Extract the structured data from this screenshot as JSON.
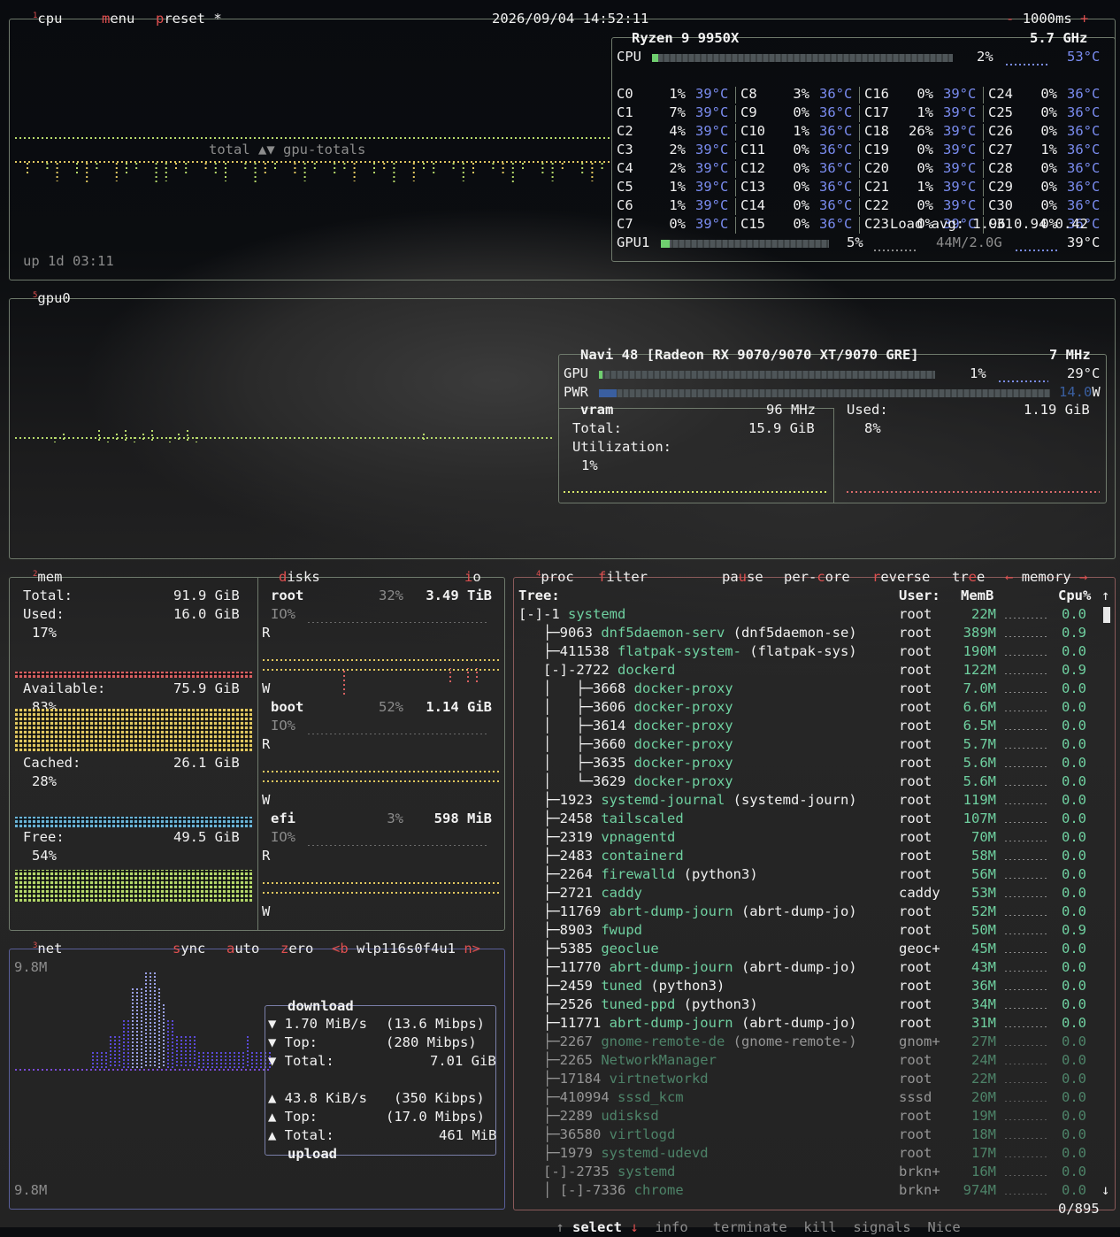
{
  "header": {
    "cpu_tab": "cpu",
    "cpu_num": "1",
    "menu": "menu",
    "preset": "preset *",
    "datetime": "2026/09/04 14:52:11",
    "rate_minus": "-",
    "rate": "1000ms",
    "rate_plus": "+"
  },
  "cpu": {
    "model": "Ryzen 9 9950X",
    "freq": "5.7 GHz",
    "label": "CPU",
    "total_pct": "2%",
    "total_temp": "53°C",
    "total_pct_value": 2,
    "graph_label_left": "total ▲▼",
    "graph_label_right": "gpu-totals",
    "uptime": "up 1d 03:11",
    "cores": [
      [
        "C0",
        "1%",
        "39°C"
      ],
      [
        "C1",
        "7%",
        "39°C"
      ],
      [
        "C2",
        "4%",
        "39°C"
      ],
      [
        "C3",
        "2%",
        "39°C"
      ],
      [
        "C4",
        "2%",
        "39°C"
      ],
      [
        "C5",
        "1%",
        "39°C"
      ],
      [
        "C6",
        "1%",
        "39°C"
      ],
      [
        "C7",
        "0%",
        "39°C"
      ],
      [
        "C8",
        "3%",
        "36°C"
      ],
      [
        "C9",
        "0%",
        "36°C"
      ],
      [
        "C10",
        "1%",
        "36°C"
      ],
      [
        "C11",
        "0%",
        "36°C"
      ],
      [
        "C12",
        "0%",
        "36°C"
      ],
      [
        "C13",
        "0%",
        "36°C"
      ],
      [
        "C14",
        "0%",
        "36°C"
      ],
      [
        "C15",
        "0%",
        "36°C"
      ],
      [
        "C16",
        "0%",
        "39°C"
      ],
      [
        "C17",
        "1%",
        "39°C"
      ],
      [
        "C18",
        "26%",
        "39°C"
      ],
      [
        "C19",
        "0%",
        "39°C"
      ],
      [
        "C20",
        "0%",
        "39°C"
      ],
      [
        "C21",
        "1%",
        "39°C"
      ],
      [
        "C22",
        "0%",
        "39°C"
      ],
      [
        "C23",
        "0%",
        "39°C"
      ],
      [
        "C24",
        "0%",
        "36°C"
      ],
      [
        "C25",
        "0%",
        "36°C"
      ],
      [
        "C26",
        "0%",
        "36°C"
      ],
      [
        "C27",
        "1%",
        "36°C"
      ],
      [
        "C28",
        "0%",
        "36°C"
      ],
      [
        "C29",
        "0%",
        "36°C"
      ],
      [
        "C30",
        "0%",
        "36°C"
      ],
      [
        "C31",
        "0%",
        "36°C"
      ]
    ],
    "load_avg": "Load avg: 1.96 0.94 0.42",
    "gpu_label": "GPU1",
    "gpu_pct": "5%",
    "gpu_pct_value": 5,
    "gpu_mem": "44M/2.0G",
    "gpu_temp": "39°C"
  },
  "gpu0": {
    "tab": "gpu0",
    "num": "5",
    "name": "Navi 48 [Radeon RX 9070/9070 XT/9070 GRE]",
    "clock": "7 MHz",
    "gpu_label": "GPU",
    "gpu_pct": "1%",
    "gpu_pct_value": 1,
    "gpu_temp": "29°C",
    "pwr_label": "PWR",
    "pwr_val": "14.0",
    "pwr_unit": "W",
    "vram_label": "vram",
    "vram_clock": "96 MHz",
    "total_label": "Total:",
    "total_val": "15.9 GiB",
    "util_label": "Utilization:",
    "util_val": "1%",
    "used_label": "Used:",
    "used_val": "1.19 GiB",
    "used_pct": "8%"
  },
  "mem": {
    "tab": "mem",
    "num": "2",
    "total_label": "Total:",
    "total_val": "91.9 GiB",
    "used_label": "Used:",
    "used_val": "16.0 GiB",
    "used_pct": "17%",
    "avail_label": "Available:",
    "avail_val": "75.9 GiB",
    "avail_pct": "83%",
    "cached_label": "Cached:",
    "cached_val": "26.1 GiB",
    "cached_pct": "28%",
    "free_label": "Free:",
    "free_val": "49.5 GiB",
    "free_pct": "54%"
  },
  "disks": {
    "tab": "disks",
    "io_tab": "io",
    "items": [
      {
        "name": "root",
        "pct": "32%",
        "size": "3.49 TiB",
        "io": "IO%",
        "r": "R",
        "w": "W"
      },
      {
        "name": "boot",
        "pct": "52%",
        "size": "1.14 GiB",
        "io": "IO%",
        "r": "R",
        "w": "W"
      },
      {
        "name": "efi",
        "pct": "3%",
        "size": "598 MiB",
        "io": "IO%",
        "r": "R",
        "w": "W"
      }
    ]
  },
  "net": {
    "tab": "net",
    "num": "3",
    "sync": "sync",
    "auto": "auto",
    "zero": "zero",
    "prev": "<b",
    "iface": "wlp116s0f4u1",
    "next": "n>",
    "scale_top": "9.8M",
    "scale_bottom": "9.8M",
    "download_title": "download",
    "dl_rate": "▼ 1.70 MiB/s",
    "dl_rate_bits": "(13.6 Mibps)",
    "dl_top_label": "▼ Top:",
    "dl_top": "(280 Mibps)",
    "dl_total_label": "▼ Total:",
    "dl_total": "7.01 GiB",
    "ul_rate": "▲ 43.8 KiB/s",
    "ul_rate_bits": "(350 Kibps)",
    "ul_top_label": "▲ Top:",
    "ul_top": "(17.0 Mibps)",
    "ul_total_label": "▲ Total:",
    "ul_total": "461 MiB",
    "upload_title": "upload"
  },
  "proc": {
    "tab": "proc",
    "num": "4",
    "filter": "filter",
    "pause": "pause",
    "per_core": "per-core",
    "reverse": "reverse",
    "tree": "tree",
    "sort_left": "←",
    "sort": "memory",
    "sort_right": "→",
    "col_tree": "Tree:",
    "col_user": "User:",
    "col_mem": "MemB",
    "col_cpu": "Cpu%",
    "rows": [
      {
        "tree": "[-]-1 ",
        "name": "systemd",
        "args": "",
        "user": "root",
        "mem": "22M",
        "cpu": "0.0"
      },
      {
        "tree": "   ├─9063 ",
        "name": "dnf5daemon-serv",
        "args": " (dnf5daemon-se)",
        "user": "root",
        "mem": "389M",
        "cpu": "0.9"
      },
      {
        "tree": "   ├─411538 ",
        "name": "flatpak-system-",
        "args": " (flatpak-sys)",
        "user": "root",
        "mem": "190M",
        "cpu": "0.0"
      },
      {
        "tree": "   [-]-2722 ",
        "name": "dockerd",
        "args": "",
        "user": "root",
        "mem": "122M",
        "cpu": "0.9"
      },
      {
        "tree": "   │   ├─3668 ",
        "name": "docker-proxy",
        "args": "",
        "user": "root",
        "mem": "7.0M",
        "cpu": "0.0"
      },
      {
        "tree": "   │   ├─3606 ",
        "name": "docker-proxy",
        "args": "",
        "user": "root",
        "mem": "6.6M",
        "cpu": "0.0"
      },
      {
        "tree": "   │   ├─3614 ",
        "name": "docker-proxy",
        "args": "",
        "user": "root",
        "mem": "6.5M",
        "cpu": "0.0"
      },
      {
        "tree": "   │   ├─3660 ",
        "name": "docker-proxy",
        "args": "",
        "user": "root",
        "mem": "5.7M",
        "cpu": "0.0"
      },
      {
        "tree": "   │   ├─3635 ",
        "name": "docker-proxy",
        "args": "",
        "user": "root",
        "mem": "5.6M",
        "cpu": "0.0"
      },
      {
        "tree": "   │   └─3629 ",
        "name": "docker-proxy",
        "args": "",
        "user": "root",
        "mem": "5.6M",
        "cpu": "0.0"
      },
      {
        "tree": "   ├─1923 ",
        "name": "systemd-journal",
        "args": " (systemd-journ)",
        "user": "root",
        "mem": "119M",
        "cpu": "0.0"
      },
      {
        "tree": "   ├─2458 ",
        "name": "tailscaled",
        "args": "",
        "user": "root",
        "mem": "107M",
        "cpu": "0.0"
      },
      {
        "tree": "   ├─2319 ",
        "name": "vpnagentd",
        "args": "",
        "user": "root",
        "mem": "70M",
        "cpu": "0.0"
      },
      {
        "tree": "   ├─2483 ",
        "name": "containerd",
        "args": "",
        "user": "root",
        "mem": "58M",
        "cpu": "0.0"
      },
      {
        "tree": "   ├─2264 ",
        "name": "firewalld",
        "args": " (python3)",
        "user": "root",
        "mem": "56M",
        "cpu": "0.0"
      },
      {
        "tree": "   ├─2721 ",
        "name": "caddy",
        "args": "",
        "user": "caddy",
        "mem": "53M",
        "cpu": "0.0"
      },
      {
        "tree": "   ├─11769 ",
        "name": "abrt-dump-journ",
        "args": " (abrt-dump-jo)",
        "user": "root",
        "mem": "52M",
        "cpu": "0.0"
      },
      {
        "tree": "   ├─8903 ",
        "name": "fwupd",
        "args": "",
        "user": "root",
        "mem": "50M",
        "cpu": "0.9"
      },
      {
        "tree": "   ├─5385 ",
        "name": "geoclue",
        "args": "",
        "user": "geoc+",
        "mem": "45M",
        "cpu": "0.0"
      },
      {
        "tree": "   ├─11770 ",
        "name": "abrt-dump-journ",
        "args": " (abrt-dump-jo)",
        "user": "root",
        "mem": "43M",
        "cpu": "0.0"
      },
      {
        "tree": "   ├─2459 ",
        "name": "tuned",
        "args": " (python3)",
        "user": "root",
        "mem": "36M",
        "cpu": "0.0"
      },
      {
        "tree": "   ├─2526 ",
        "name": "tuned-ppd",
        "args": " (python3)",
        "user": "root",
        "mem": "34M",
        "cpu": "0.0"
      },
      {
        "tree": "   ├─11771 ",
        "name": "abrt-dump-journ",
        "args": " (abrt-dump-jo)",
        "user": "root",
        "mem": "31M",
        "cpu": "0.0"
      },
      {
        "tree": "   ├─2267 ",
        "name": "gnome-remote-de",
        "args": " (gnome-remote-)",
        "user": "gnom+",
        "mem": "27M",
        "cpu": "0.0"
      },
      {
        "tree": "   ├─2265 ",
        "name": "NetworkManager",
        "args": "",
        "user": "root",
        "mem": "24M",
        "cpu": "0.0"
      },
      {
        "tree": "   ├─17184 ",
        "name": "virtnetworkd",
        "args": "",
        "user": "root",
        "mem": "22M",
        "cpu": "0.0"
      },
      {
        "tree": "   ├─410994 ",
        "name": "sssd_kcm",
        "args": "",
        "user": "sssd",
        "mem": "20M",
        "cpu": "0.0"
      },
      {
        "tree": "   ├─2289 ",
        "name": "udisksd",
        "args": "",
        "user": "root",
        "mem": "19M",
        "cpu": "0.0"
      },
      {
        "tree": "   ├─36580 ",
        "name": "virtlogd",
        "args": "",
        "user": "root",
        "mem": "18M",
        "cpu": "0.0"
      },
      {
        "tree": "   ├─1979 ",
        "name": "systemd-udevd",
        "args": "",
        "user": "root",
        "mem": "17M",
        "cpu": "0.0"
      },
      {
        "tree": "   [-]-2735 ",
        "name": "systemd",
        "args": "",
        "user": "brkn+",
        "mem": "16M",
        "cpu": "0.0"
      },
      {
        "tree": "   │ [-]-7336 ",
        "name": "chrome",
        "args": "",
        "user": "brkn+",
        "mem": "974M",
        "cpu": "0.0"
      }
    ],
    "footer": {
      "up": "↑",
      "select": "select",
      "down": "↓",
      "info": "info",
      "terminate": "terminate",
      "kill": "kill",
      "signals": "signals",
      "nice": "Nice",
      "count": "0/895"
    }
  },
  "colors": {
    "accent": "#e05050",
    "temp": "#7a8cf0",
    "border": "#6f7a6c",
    "graph_green": "#b5d86a",
    "graph_yellow": "#e2c860",
    "graph_cyan": "#6ab5d8",
    "net_blue": "#6a5ad8"
  }
}
